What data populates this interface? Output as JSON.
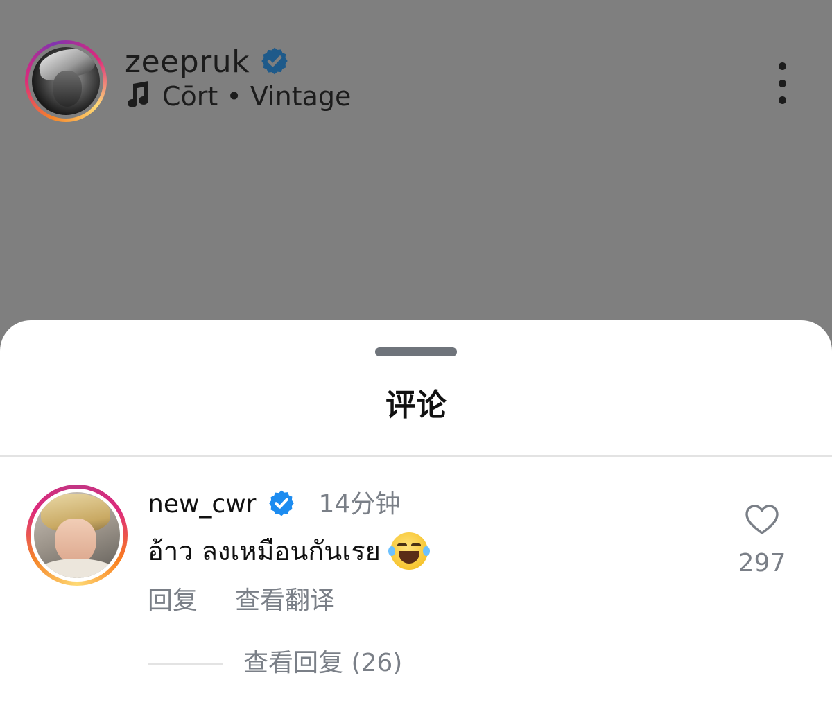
{
  "post": {
    "username": "zeepruk",
    "music": "Cōrt • Vintage",
    "icons": {
      "verified": "verified-badge-icon",
      "music": "music-note-icon",
      "more": "more-vertical-icon"
    }
  },
  "sheet": {
    "title": "评论"
  },
  "comment": {
    "username": "new_cwr",
    "time": "14分钟",
    "text": "อ้าว ลงเหมือนกันเรย",
    "emoji": "face-with-tears-of-joy",
    "reply_label": "回复",
    "translate_label": "查看翻译",
    "view_replies_label": "查看回复 (26)",
    "like_count": "297",
    "icons": {
      "verified": "verified-badge-icon",
      "like": "heart-outline-icon"
    }
  },
  "colors": {
    "dim_overlay": "#7f7f7f",
    "verified_blue": "#1d8cf0",
    "muted_text": "#7a7f87",
    "primary_text": "#111111",
    "handle": "#6f747b"
  }
}
